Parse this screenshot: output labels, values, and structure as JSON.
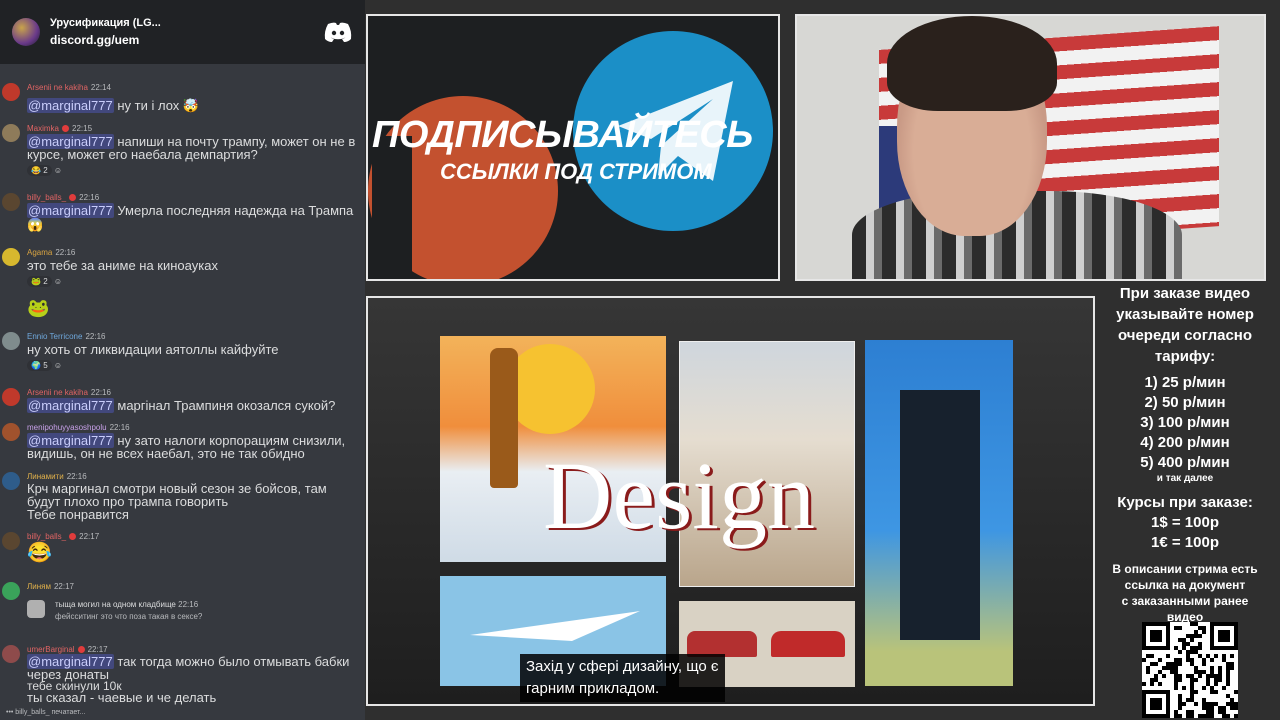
{
  "discord": {
    "server_name": "Урусификация (LG...",
    "invite": "discord.gg/uem"
  },
  "chat": {
    "typing": "billy_balls_ печатает..."
  },
  "messages": [
    {
      "author": "Arsenii ne kakiha",
      "author_color": "#e06464",
      "time": "22:14",
      "mention": "@marginal777",
      "lines": [
        "ну ти і лох"
      ],
      "avatar_color": "#c0392b"
    },
    {
      "author": "Maximka",
      "author_color": "#e06464",
      "time": "22:15",
      "mention": "@marginal777",
      "lines": [
        "напиши на почту трампу, может он не в",
        "курсе, может его наебала демпартия?"
      ],
      "react": "2",
      "avatar_color": "#8e7b5a"
    },
    {
      "author": "billy_balls_",
      "author_color": "#e06464",
      "time": "22:16",
      "mention": "@marginal777",
      "lines": [
        "Умерла последняя надежда на Трампа"
      ],
      "avatar_color": "#5a4630"
    },
    {
      "author": "Agama",
      "author_color": "#d9a441",
      "time": "22:16",
      "lines": [
        "это тебе за аниме на киноауках"
      ],
      "react": "2",
      "avatar_color": "#d7b82e"
    },
    {
      "author": "Ennio Terricone",
      "author_color": "#6fa8dc",
      "time": "22:16",
      "lines": [
        "ну хоть от ликвидации аятоллы кайфуйте"
      ],
      "react": "5",
      "avatar_color": "#7f8c8d"
    },
    {
      "author": "Arsenii ne kakiha",
      "author_color": "#e06464",
      "time": "22:16",
      "mention": "@marginal777",
      "lines": [
        "маргінал Трампиня окозался сукой?"
      ],
      "avatar_color": "#c0392b"
    },
    {
      "author": "menipohuyyasoshpolu",
      "author_color": "#c7a0e8",
      "time": "22:16",
      "mention": "@marginal777",
      "lines": [
        "ну зато налоги корпорациям снизили,",
        "видишь, он не всех наебал, это не так обидно"
      ],
      "avatar_color": "#a0522d"
    },
    {
      "author": "Линамити",
      "author_color": "#e0b04a",
      "time": "22:16",
      "lines": [
        "Крч маргинал смотри новый сезон зе бойсов, там",
        "будут плохо про трампа говорить",
        "Тебе понравится"
      ],
      "avatar_color": "#2e5c8a"
    },
    {
      "author": "billy_balls_",
      "author_color": "#e06464",
      "time": "22:17",
      "avatar_color": "#5a4630"
    },
    {
      "author": "Линям",
      "author_color": "#e0b04a",
      "time": "22:17",
      "avatar_color": "#3aa35a"
    },
    {
      "author": "umerBarginal",
      "author_color": "#e06464",
      "time": "22:17",
      "mention": "@marginal777",
      "lines": [
        "так тогда можно было отмывать бабки",
        "через донаты",
        "тебе скинули 10к",
        "ты сказал - чаевые и че делать"
      ],
      "avatar_color": "#8e4b4b"
    }
  ],
  "reply": {
    "text": "тыща могил на одном кладбище",
    "time": "22:16",
    "sub": "фейсситинг это что поза такая в сексе?"
  },
  "promo": {
    "title": "ПОДПИСЫВАЙТЕСЬ",
    "subtitle": "ССЫЛКИ ПОД СТРИМОМ"
  },
  "design": {
    "word": "Design",
    "caption_line1": "Захід у сфері дизайну, що є",
    "caption_line2": "гарним прикладом."
  },
  "info": {
    "heading": [
      "При заказе видео",
      "указывайте номер",
      "очереди согласно",
      "тарифу:"
    ],
    "tariffs": [
      "1) 25 р/мин",
      "2) 50 р/мин",
      "3) 100 р/мин",
      "4) 200 р/мин",
      "5) 400 р/мин"
    ],
    "etc": "и так далее",
    "courses_title": "Курсы при заказе:",
    "courses": [
      "1$ = 100р",
      "1€ = 100р"
    ],
    "description": [
      "В описании стрима есть",
      "ссылка на документ",
      "с заказанными ранее",
      "видео"
    ]
  }
}
